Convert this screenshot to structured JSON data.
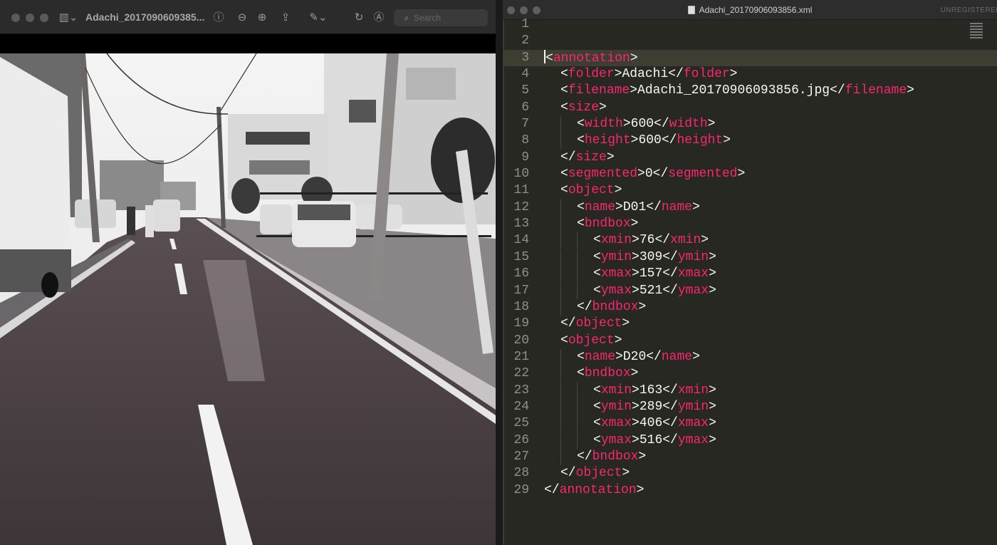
{
  "preview": {
    "title": "Adachi_2017090609385...",
    "search_placeholder": "Search",
    "icons": [
      "sidebar-icon",
      "info-icon",
      "zoom-out-icon",
      "zoom-in-icon",
      "share-icon",
      "markup-icon",
      "rotate-icon",
      "annotate-icon",
      "search-icon"
    ]
  },
  "editor": {
    "title": "Adachi_20170906093856.xml",
    "unregistered": "UNREGISTERED",
    "lines": [
      {
        "n": "1",
        "indent": 0,
        "text": ""
      },
      {
        "n": "2",
        "indent": 0,
        "text": ""
      },
      {
        "n": "3",
        "indent": 0,
        "text": "<annotation>"
      },
      {
        "n": "4",
        "indent": 1,
        "text": "<folder>Adachi</folder>"
      },
      {
        "n": "5",
        "indent": 1,
        "text": "<filename>Adachi_20170906093856.jpg</filename>"
      },
      {
        "n": "6",
        "indent": 1,
        "text": "<size>"
      },
      {
        "n": "7",
        "indent": 2,
        "text": "<width>600</width>"
      },
      {
        "n": "8",
        "indent": 2,
        "text": "<height>600</height>"
      },
      {
        "n": "9",
        "indent": 1,
        "text": "</size>"
      },
      {
        "n": "10",
        "indent": 1,
        "text": "<segmented>0</segmented>"
      },
      {
        "n": "11",
        "indent": 1,
        "text": "<object>"
      },
      {
        "n": "12",
        "indent": 2,
        "text": "<name>D01</name>"
      },
      {
        "n": "13",
        "indent": 2,
        "text": "<bndbox>"
      },
      {
        "n": "14",
        "indent": 3,
        "text": "<xmin>76</xmin>"
      },
      {
        "n": "15",
        "indent": 3,
        "text": "<ymin>309</ymin>"
      },
      {
        "n": "16",
        "indent": 3,
        "text": "<xmax>157</xmax>"
      },
      {
        "n": "17",
        "indent": 3,
        "text": "<ymax>521</ymax>"
      },
      {
        "n": "18",
        "indent": 2,
        "text": "</bndbox>"
      },
      {
        "n": "19",
        "indent": 1,
        "text": "</object>"
      },
      {
        "n": "20",
        "indent": 1,
        "text": "<object>"
      },
      {
        "n": "21",
        "indent": 2,
        "text": "<name>D20</name>"
      },
      {
        "n": "22",
        "indent": 2,
        "text": "<bndbox>"
      },
      {
        "n": "23",
        "indent": 3,
        "text": "<xmin>163</xmin>"
      },
      {
        "n": "24",
        "indent": 3,
        "text": "<ymin>289</ymin>"
      },
      {
        "n": "25",
        "indent": 3,
        "text": "<xmax>406</xmax>"
      },
      {
        "n": "26",
        "indent": 3,
        "text": "<ymax>516</ymax>"
      },
      {
        "n": "27",
        "indent": 2,
        "text": "</bndbox>"
      },
      {
        "n": "28",
        "indent": 1,
        "text": "</object>"
      },
      {
        "n": "29",
        "indent": 0,
        "text": "</annotation>"
      }
    ],
    "cursor_line": "3"
  },
  "colors": {
    "editor_bg": "#272822",
    "tag": "#f92672",
    "text": "#f8f8f2",
    "line_number": "#90908a"
  }
}
